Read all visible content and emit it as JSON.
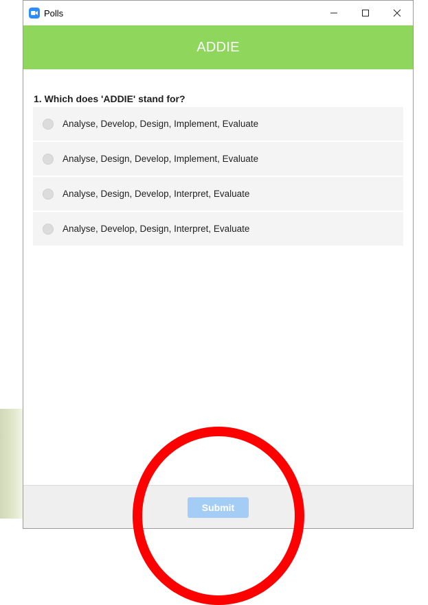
{
  "window": {
    "title": "Polls",
    "icon": "zoom-camera-icon",
    "controls": [
      "minimize-icon",
      "maximize-icon",
      "close-icon"
    ]
  },
  "header": {
    "title": "ADDIE",
    "color": "#8ed65c"
  },
  "poll": {
    "question": "1. Which does 'ADDIE' stand for?",
    "options": [
      {
        "label": "Analyse, Develop, Design, Implement, Evaluate",
        "selected": false
      },
      {
        "label": "Analyse, Design, Develop, Implement, Evaluate",
        "selected": false
      },
      {
        "label": "Analyse, Design, Develop, Interpret, Evaluate",
        "selected": false
      },
      {
        "label": "Analyse, Develop, Design, Interpret, Evaluate",
        "selected": false
      }
    ]
  },
  "footer": {
    "submit_label": "Submit",
    "submit_enabled": false
  },
  "annotation": {
    "shape": "circle",
    "color": "#ff0000",
    "target": "submit-button"
  }
}
